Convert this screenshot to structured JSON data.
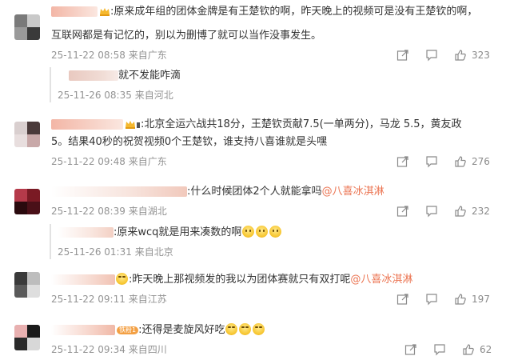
{
  "comments": [
    {
      "text_line1": ":原来成年组的团体金牌是有王楚钦的啊，昨天晚上的视频可是没有王楚钦的啊，",
      "text_line2": "互联网都是有记忆的，别以为删博了就可以当作没事发生。",
      "time": "25-11-22 08:58",
      "location": "来自广东",
      "likes": "323",
      "reply": {
        "text": "就不发能咋滴",
        "time": "25-11-26 08:35",
        "location": "来自河北"
      }
    },
    {
      "text_line1": ":北京全运六战共18分，王楚钦贡献7.5(一单两分)，马龙 5.5，黄友政",
      "text_line2": "5。结果40秒的祝贺视频0个王楚钦，谁支持八喜谁就是头嘿",
      "time": "25-11-22 09:48",
      "location": "来自广东",
      "likes": "276"
    },
    {
      "text_line1": ":什么时候团体2个人就能拿吗",
      "mention": "@八喜冰淇淋",
      "time": "25-11-22 08:39",
      "location": "来自湖北",
      "likes": "232",
      "reply": {
        "text": ":原来wcq就是用来凑数的啊",
        "time": "25-11-26 01:31",
        "location": "来自北京"
      }
    },
    {
      "text_line1": ":昨天晚上那视频发的我以为团体赛就只有双打呢",
      "mention": "@八喜冰淇淋",
      "time": "25-11-22 09:11",
      "location": "来自江苏",
      "likes": "197"
    },
    {
      "text_line1": ":还得是麦旋风好吃",
      "badge": "铁粉1",
      "time": "25-11-22 09:34",
      "location": "来自四川",
      "likes": "62"
    }
  ],
  "icons": [
    "share-icon",
    "comment-icon",
    "like-icon",
    "crown-icon",
    "emoji-icon"
  ],
  "colors": {
    "mention": "#eb7350",
    "meta": "#939393",
    "text": "#333333"
  }
}
